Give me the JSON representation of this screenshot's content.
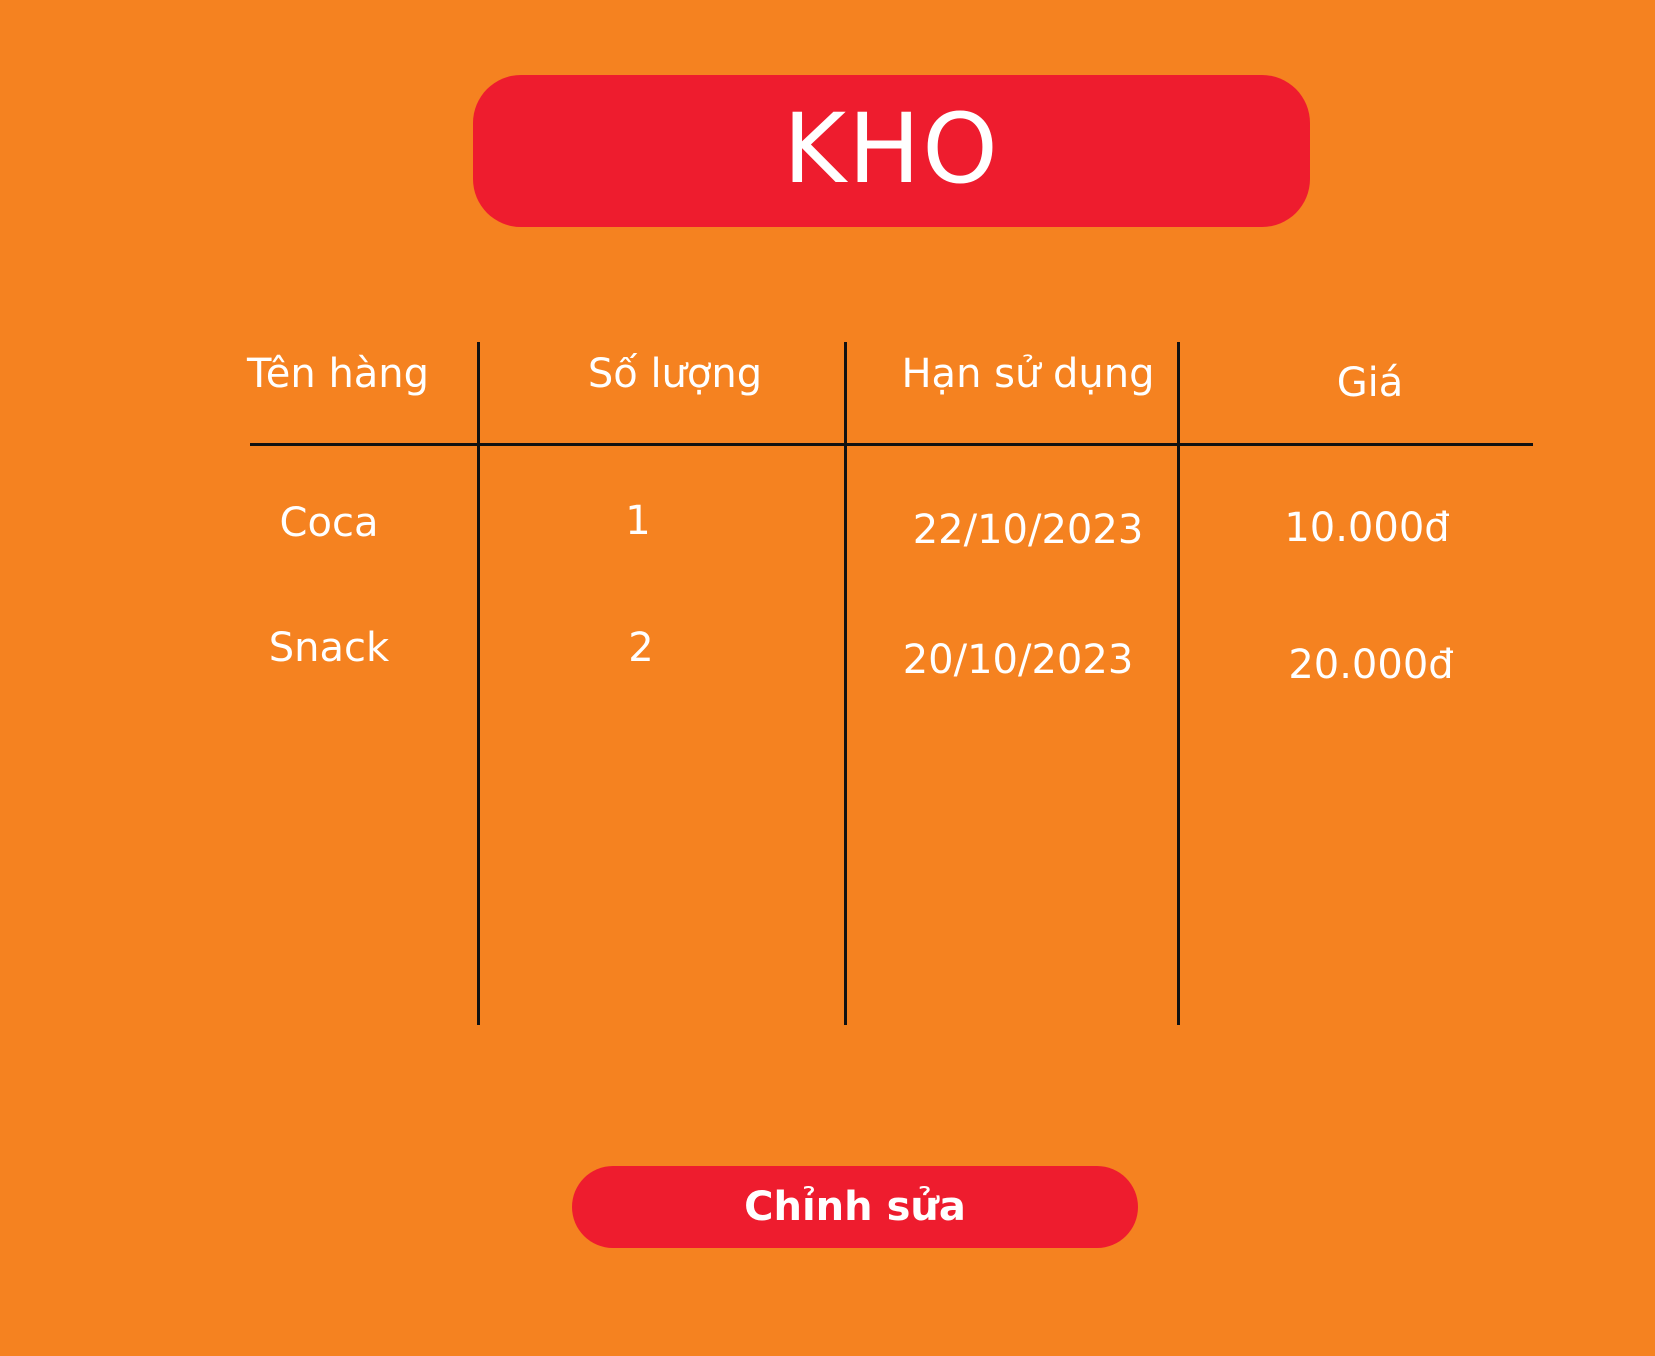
{
  "header": {
    "title": "KHO"
  },
  "table": {
    "columns": [
      "Tên hàng",
      "Số lượng",
      "Hạn sử dụng",
      "Giá"
    ],
    "rows": [
      [
        "Coca",
        "1",
        "22/10/2023",
        "10.000đ"
      ],
      [
        "Snack",
        "2",
        "20/10/2023",
        "20.000đ"
      ]
    ]
  },
  "actions": {
    "edit_label": "Chỉnh sửa"
  },
  "colors": {
    "background": "#F58220",
    "accent": "#EE1C2E",
    "text": "#FFFFFF",
    "grid_lines": "#111111"
  }
}
